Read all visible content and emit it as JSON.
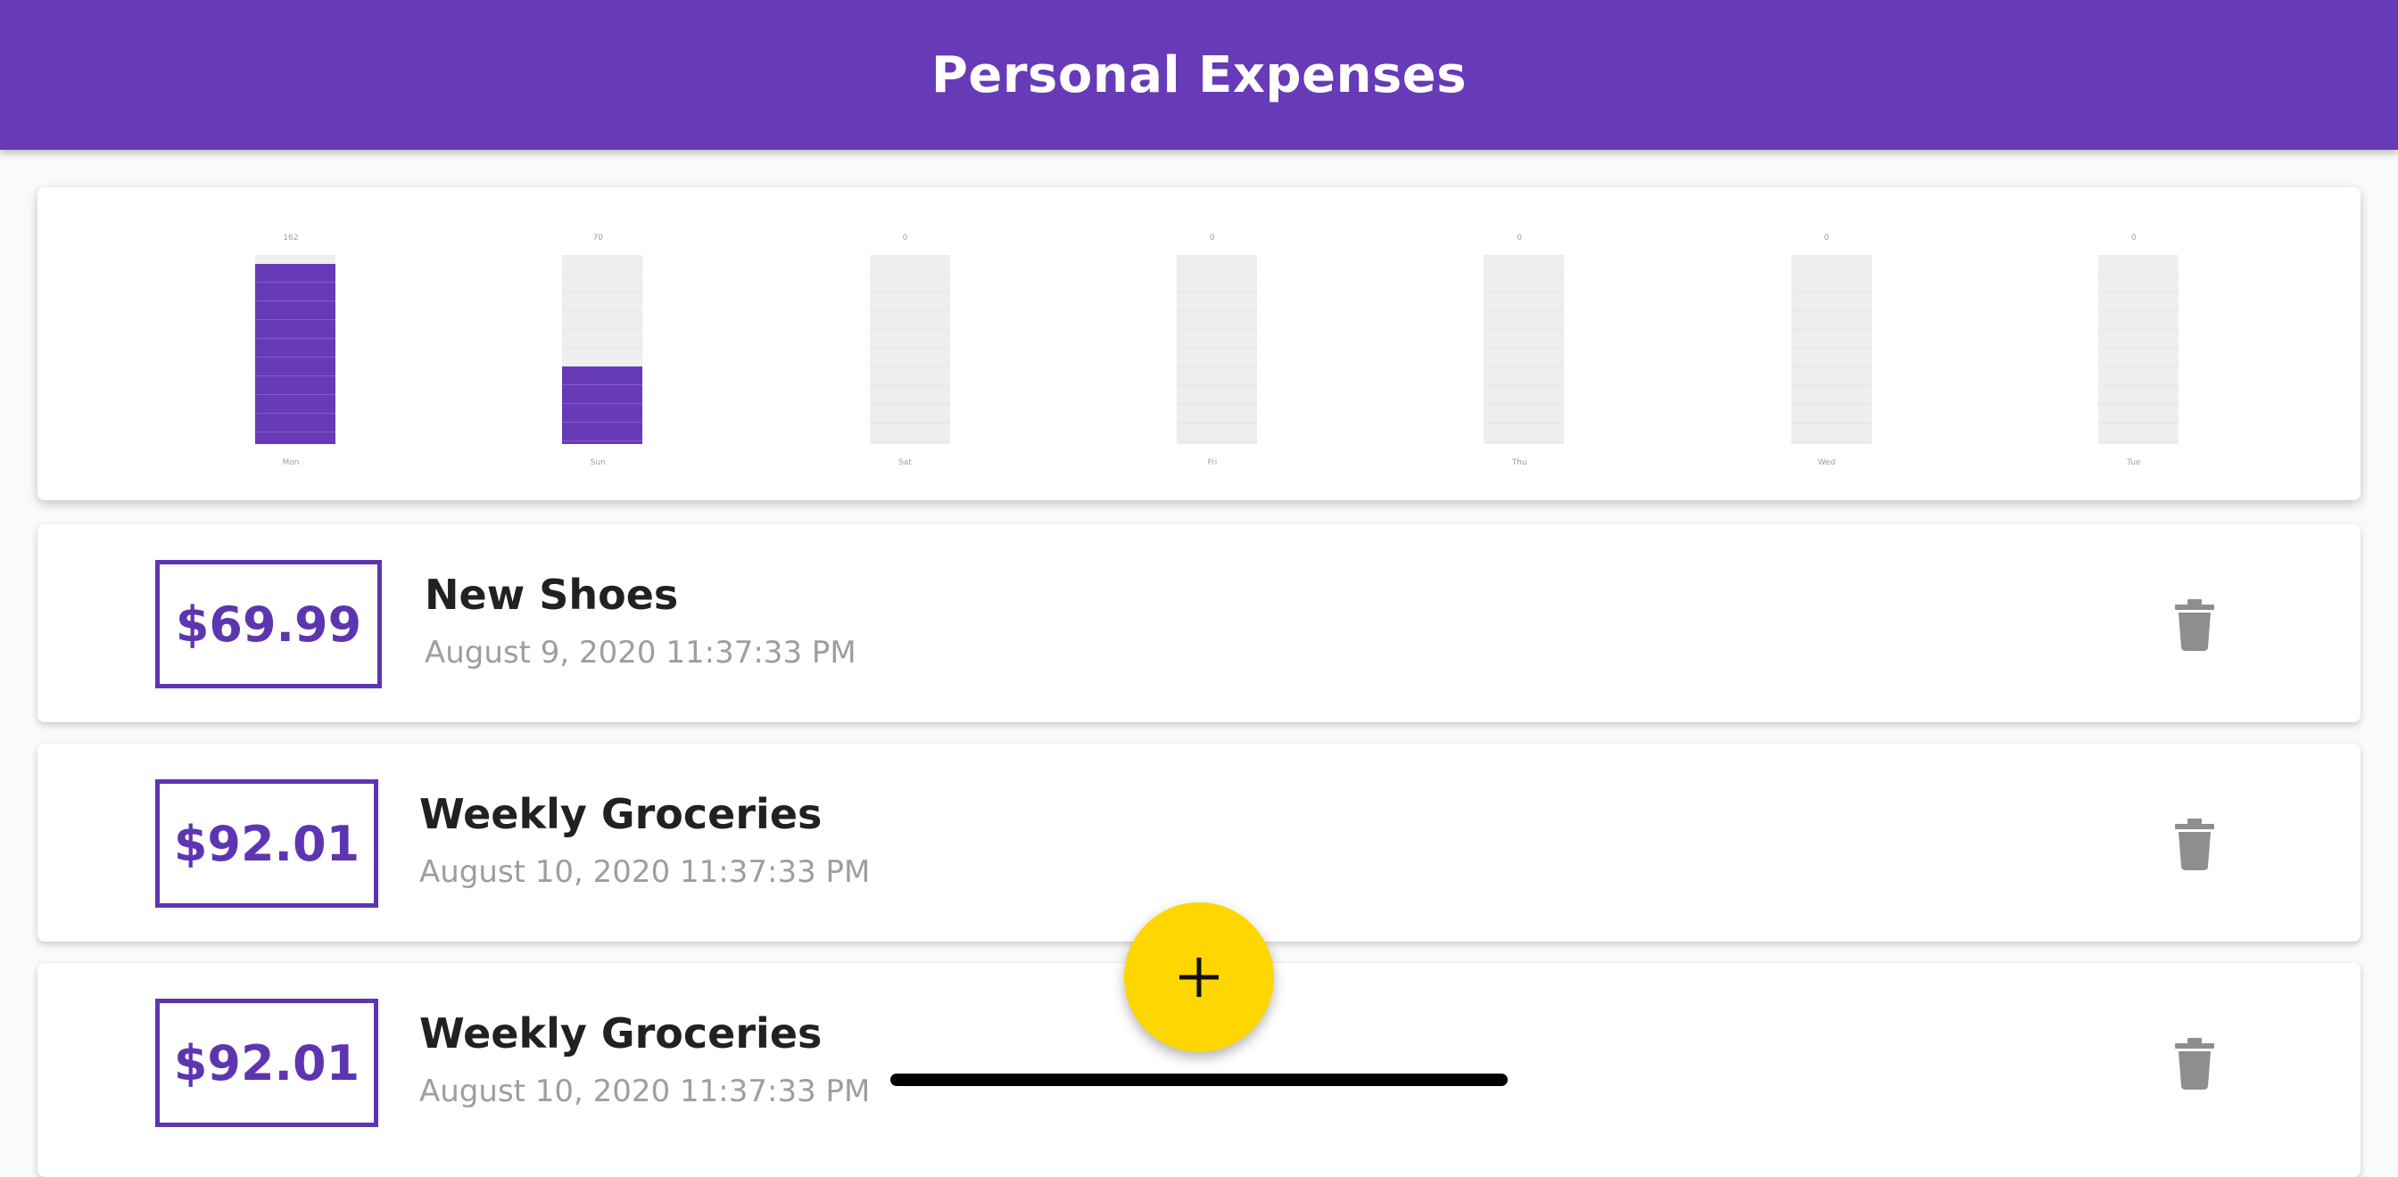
{
  "appbar": {
    "title": "Personal Expenses"
  },
  "chart_data": {
    "type": "bar",
    "categories": [
      "Mon",
      "Sun",
      "Sat",
      "Fri",
      "Thu",
      "Wed",
      "Tue"
    ],
    "values": [
      162,
      70,
      0,
      0,
      0,
      0,
      0
    ],
    "value_labels": [
      "162",
      "70",
      "0",
      "0",
      "0",
      "0",
      "0"
    ],
    "ylim": [
      0,
      170
    ],
    "bar_color": "#673ab7",
    "track_color": "#eeeeee"
  },
  "transactions": [
    {
      "amount": "$69.99",
      "title": "New Shoes",
      "date": "August 9, 2020 11:37:33 PM"
    },
    {
      "amount": "$92.01",
      "title": "Weekly Groceries",
      "date": "August 10, 2020 11:37:33 PM"
    },
    {
      "amount": "$92.01",
      "title": "Weekly Groceries",
      "date": "August 10, 2020 11:37:33 PM"
    }
  ],
  "icons": {
    "delete": "trash-icon",
    "add": "plus-icon"
  },
  "colors": {
    "primary": "#673ab7",
    "accent": "#ffd600",
    "price": "#5e35b1"
  }
}
